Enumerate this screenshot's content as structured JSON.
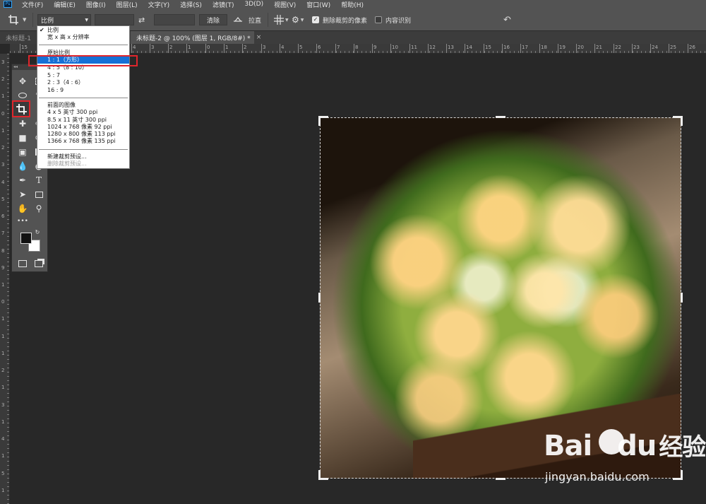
{
  "app": {
    "logo_text": "Ps"
  },
  "menubar": {
    "items": [
      "文件(F)",
      "编辑(E)",
      "图像(I)",
      "图层(L)",
      "文字(Y)",
      "选择(S)",
      "滤镜(T)",
      "3D(D)",
      "视图(V)",
      "窗口(W)",
      "帮助(H)"
    ]
  },
  "options": {
    "tool_icon": "crop-icon",
    "ratio_value": "比例",
    "swap_icon": "swap-arrows-icon",
    "clear_label": "清除",
    "straighten_label": "拉直",
    "delete_cropped_label": "删除裁剪的像素",
    "delete_cropped_checked": true,
    "content_aware_label": "内容识别",
    "content_aware_checked": false,
    "reset_icon": "undo-icon"
  },
  "tabs": [
    {
      "label": "未标题-1",
      "active": false
    },
    {
      "label": "未标题-2 @ 100% (图层 1, RGB/8#) *",
      "active": true,
      "close": "×"
    }
  ],
  "rulers": {
    "h_numbers": [
      "15",
      "9",
      "8",
      "7",
      "6",
      "5",
      "4",
      "3",
      "2",
      "1",
      "0",
      "1",
      "2",
      "3",
      "4",
      "5",
      "6",
      "7",
      "8",
      "9",
      "10",
      "11",
      "12",
      "13",
      "14",
      "15",
      "16",
      "17",
      "18",
      "19",
      "20",
      "21",
      "22",
      "23",
      "24",
      "25",
      "26"
    ],
    "v_numbers": [
      "3",
      "2",
      "1",
      "0",
      "1",
      "2",
      "3",
      "4",
      "5",
      "6",
      "7",
      "8",
      "9",
      "1",
      "0",
      "1",
      "1",
      "1",
      "2",
      "1",
      "3",
      "1",
      "4",
      "1",
      "5",
      "1"
    ]
  },
  "ratio_dropdown": {
    "items": [
      {
        "label": "比例",
        "checked": true
      },
      {
        "label": "宽 x 高 x 分辨率"
      },
      {
        "label": "原始比例"
      },
      {
        "label": "1 : 1（方形）",
        "selected": true
      },
      {
        "label": "4 : 5（8 : 10）"
      },
      {
        "label": "5 : 7"
      },
      {
        "label": "2 : 3（4 : 6）"
      },
      {
        "label": "16 : 9"
      },
      {
        "label": "前面的图像"
      },
      {
        "label": "4 x 5 英寸 300 ppi"
      },
      {
        "label": "8.5 x 11 英寸 300 ppi"
      },
      {
        "label": "1024 x 768 像素 92 ppi"
      },
      {
        "label": "1280 x 800 像素 113 ppi"
      },
      {
        "label": "1366 x 768 像素 135 ppi"
      },
      {
        "label": "新建裁剪预设..."
      },
      {
        "label": "删除裁剪预设...",
        "disabled": true
      }
    ]
  },
  "tools": {
    "grip": "◂◂",
    "items": [
      "move-icon",
      "marquee-icon",
      "lasso-icon",
      "quick-select-icon",
      "crop-icon",
      "eyedropper-icon",
      "healing-icon",
      "brush-icon",
      "stamp-icon",
      "history-brush-icon",
      "eraser-icon",
      "gradient-icon",
      "blur-icon",
      "dodge-icon",
      "pen-icon",
      "type-icon",
      "path-select-icon",
      "rectangle-icon",
      "hand-icon",
      "zoom-icon",
      "more-tools-icon"
    ],
    "type_glyph": "T",
    "more_glyph": "•••"
  },
  "watermark": {
    "logo": "Bai",
    "logo_suffix": "du",
    "right": "经验",
    "url": "jingyan.baidu.com"
  }
}
